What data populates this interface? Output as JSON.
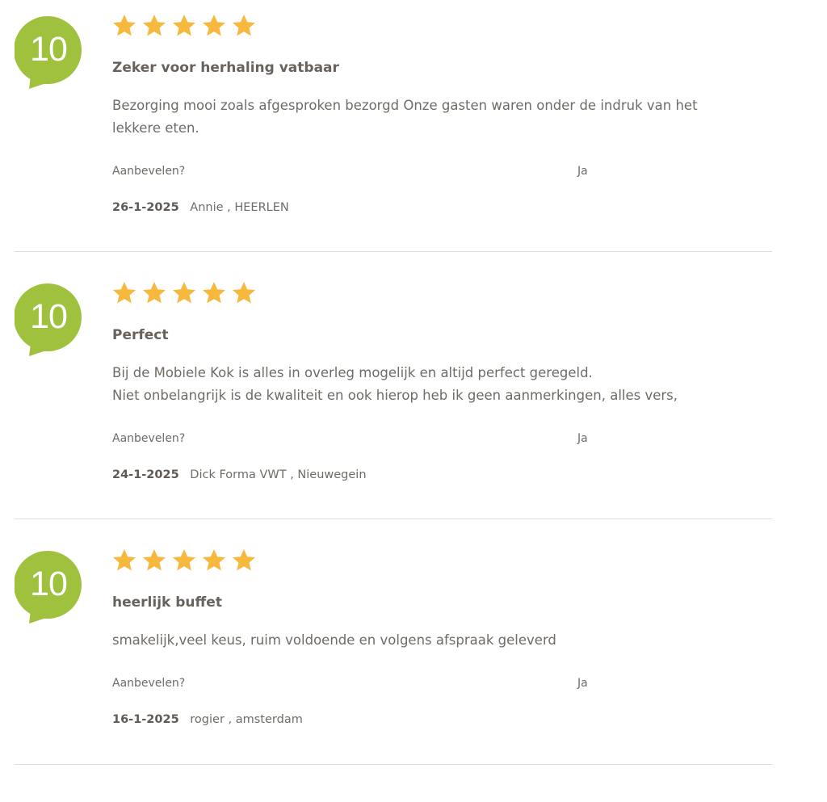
{
  "colors": {
    "score_bubble": "#9fc13e",
    "star": "#f6b93d",
    "text": "#6f6b66",
    "divider": "#dddddd"
  },
  "icons": {
    "score": "speech-bubble",
    "rating": "star"
  },
  "reviews": [
    {
      "score": "10",
      "stars": 5,
      "title": "Zeker voor herhaling vatbaar",
      "body_lines": [
        "Bezorging mooi zoals afgesproken bezorgd Onze gasten waren onder de indruk van het",
        "lekkere eten."
      ],
      "recommend_label": "Aanbevelen?",
      "recommend_value": "Ja",
      "date": "26-1-2025",
      "author": "Annie , HEERLEN"
    },
    {
      "score": "10",
      "stars": 5,
      "title": "Perfect",
      "body_lines": [
        "Bij de Mobiele Kok is alles in overleg mogelijk en altijd perfect geregeld.",
        "Niet onbelangrijk is de kwaliteit en ook hierop heb ik geen aanmerkingen, alles vers,"
      ],
      "recommend_label": "Aanbevelen?",
      "recommend_value": "Ja",
      "date": "24-1-2025",
      "author": "Dick Forma VWT , Nieuwegein"
    },
    {
      "score": "10",
      "stars": 5,
      "title": "heerlijk buffet",
      "body_lines": [
        "smakelijk,veel keus, ruim voldoende en volgens afspraak geleverd"
      ],
      "recommend_label": "Aanbevelen?",
      "recommend_value": "Ja",
      "date": "16-1-2025",
      "author": "rogier , amsterdam"
    }
  ]
}
